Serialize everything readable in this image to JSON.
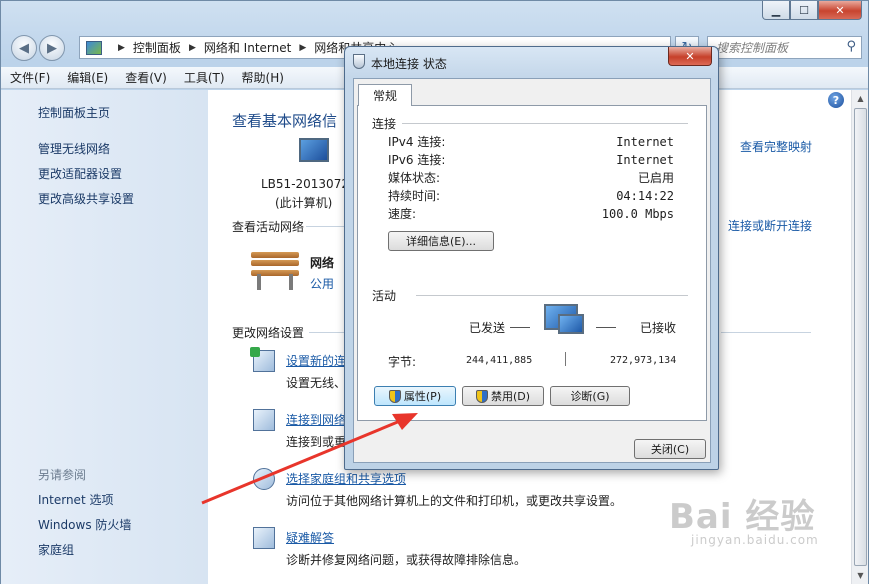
{
  "address_bar": {
    "crumbs": [
      "控制面板",
      "网络和 Internet",
      "网络和共享中心"
    ]
  },
  "search": {
    "placeholder": "搜索控制面板"
  },
  "menu": [
    "文件(F)",
    "编辑(E)",
    "查看(V)",
    "工具(T)",
    "帮助(H)"
  ],
  "sidebar": {
    "items": [
      "控制面板主页",
      "管理无线网络",
      "更改适配器设置",
      "更改高级共享设置"
    ],
    "see_also": "另请参阅",
    "see_also_items": [
      "Internet 选项",
      "Windows 防火墙",
      "家庭组"
    ]
  },
  "main": {
    "title": "查看基本网络信",
    "full_map": "查看完整映射",
    "computer_name": "LB51-2013072",
    "computer_note": "(此计算机)",
    "active_networks": "查看活动网络",
    "connect_disconnect": "连接或断开连接",
    "network_name": "网络",
    "network_type": "公用",
    "change_settings": "更改网络设置",
    "tasks": [
      {
        "title": "设置新的连",
        "desc": "设置无线、"
      },
      {
        "title": "连接到网络",
        "desc": "连接到或重"
      },
      {
        "title": "选择家庭组和共享选项",
        "desc": "访问位于其他网络计算机上的文件和打印机，或更改共享设置。"
      },
      {
        "title": "疑难解答",
        "desc": "诊断并修复网络问题，或获得故障排除信息。"
      }
    ]
  },
  "dialog": {
    "title": "本地连接 状态",
    "tab": "常规",
    "connection_section": "连接",
    "rows": [
      {
        "label": "IPv4 连接:",
        "value": "Internet"
      },
      {
        "label": "IPv6 连接:",
        "value": "Internet"
      },
      {
        "label": "媒体状态:",
        "value": "已启用"
      },
      {
        "label": "持续时间:",
        "value": "04:14:22"
      },
      {
        "label": "速度:",
        "value": "100.0 Mbps"
      }
    ],
    "details_button": "详细信息(E)...",
    "activity_section": "活动",
    "sent_label": "已发送",
    "received_label": "已接收",
    "bytes_label": "字节:",
    "bytes_sent": "244,411,885",
    "bytes_received": "272,973,134",
    "properties_button": "属性(P)",
    "disable_button": "禁用(D)",
    "diagnose_button": "诊断(G)",
    "close_button": "关闭(C)"
  },
  "watermark": {
    "brand": "Bai 经验",
    "url": "jingyan.baidu.com"
  },
  "colors": {
    "annotation_arrow": "#e8352b",
    "link": "#1a5aa6"
  }
}
